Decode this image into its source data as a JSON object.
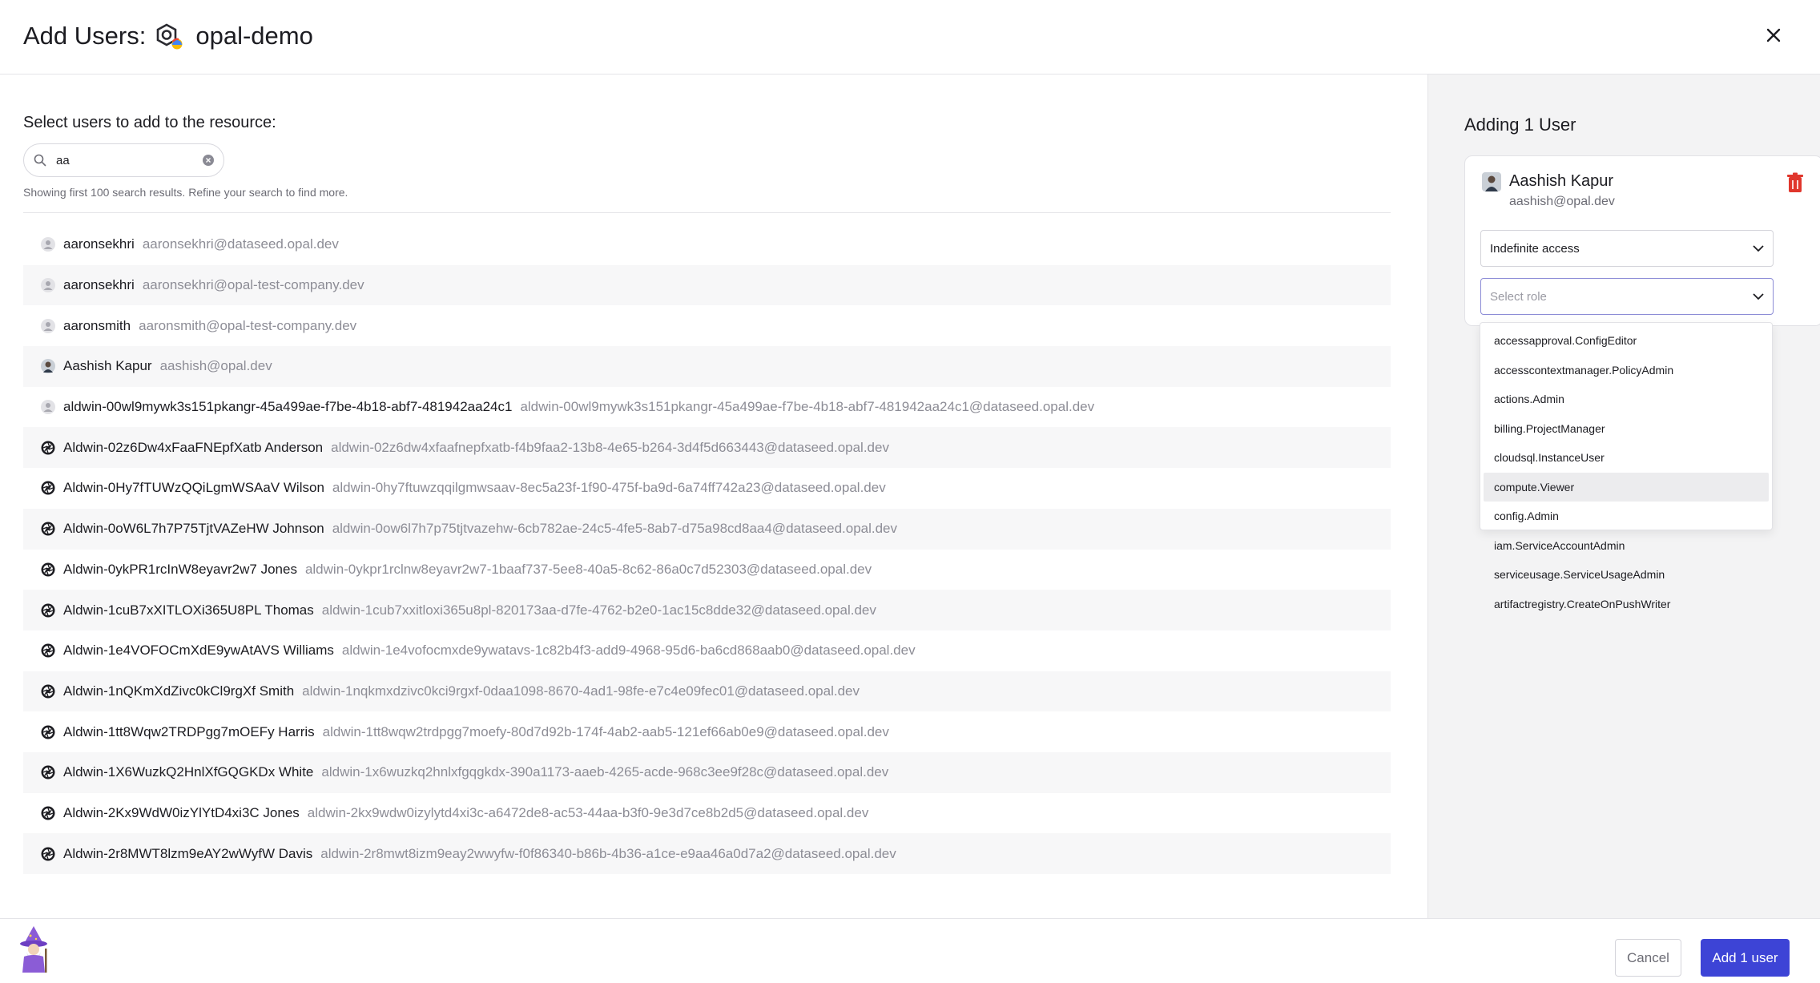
{
  "modal": {
    "title": "Add Users:",
    "resource_name": "opal-demo",
    "resource_icon": "gcp-project-icon"
  },
  "search": {
    "section_label": "Select users to add to the resource:",
    "value": "aa",
    "hint": "Showing first 100 search results. Refine your search to find more."
  },
  "users": [
    {
      "name": "aaronsekhri",
      "email": "aaronsekhri@dataseed.opal.dev",
      "avatar": "default"
    },
    {
      "name": "aaronsekhri",
      "email": "aaronsekhri@opal-test-company.dev",
      "avatar": "default"
    },
    {
      "name": "aaronsmith",
      "email": "aaronsmith@opal-test-company.dev",
      "avatar": "default"
    },
    {
      "name": "Aashish Kapur",
      "email": "aashish@opal.dev",
      "avatar": "photo"
    },
    {
      "name": "aldwin-00wl9mywk3s151pkangr-45a499ae-f7be-4b18-abf7-481942aa24c1",
      "email": "aldwin-00wl9mywk3s151pkangr-45a499ae-f7be-4b18-abf7-481942aa24c1@dataseed.opal.dev",
      "avatar": "default"
    },
    {
      "name": "Aldwin-02z6Dw4xFaaFNEpfXatb Anderson",
      "email": "aldwin-02z6dw4xfaafnepfxatb-f4b9faa2-13b8-4e65-b264-3d4f5d663443@dataseed.opal.dev",
      "avatar": "aperture"
    },
    {
      "name": "Aldwin-0Hy7fTUWzQQiLgmWSAaV Wilson",
      "email": "aldwin-0hy7ftuwzqqilgmwsaav-8ec5a23f-1f90-475f-ba9d-6a74ff742a23@dataseed.opal.dev",
      "avatar": "aperture"
    },
    {
      "name": "Aldwin-0oW6L7h7P75TjtVAZeHW Johnson",
      "email": "aldwin-0ow6l7h7p75tjtvazehw-6cb782ae-24c5-4fe5-8ab7-d75a98cd8aa4@dataseed.opal.dev",
      "avatar": "aperture"
    },
    {
      "name": "Aldwin-0ykPR1rcInW8eyavr2w7 Jones",
      "email": "aldwin-0ykpr1rclnw8eyavr2w7-1baaf737-5ee8-40a5-8c62-86a0c7d52303@dataseed.opal.dev",
      "avatar": "aperture"
    },
    {
      "name": "Aldwin-1cuB7xXITLOXi365U8PL Thomas",
      "email": "aldwin-1cub7xxitloxi365u8pl-820173aa-d7fe-4762-b2e0-1ac15c8dde32@dataseed.opal.dev",
      "avatar": "aperture"
    },
    {
      "name": "Aldwin-1e4VOFOCmXdE9ywAtAVS Williams",
      "email": "aldwin-1e4vofocmxde9ywatavs-1c82b4f3-add9-4968-95d6-ba6cd868aab0@dataseed.opal.dev",
      "avatar": "aperture"
    },
    {
      "name": "Aldwin-1nQKmXdZivc0kCl9rgXf Smith",
      "email": "aldwin-1nqkmxdzivc0kci9rgxf-0daa1098-8670-4ad1-98fe-e7c4e09fec01@dataseed.opal.dev",
      "avatar": "aperture"
    },
    {
      "name": "Aldwin-1tt8Wqw2TRDPgg7mOEFy Harris",
      "email": "aldwin-1tt8wqw2trdpgg7moefy-80d7d92b-174f-4ab2-aab5-121ef66ab0e9@dataseed.opal.dev",
      "avatar": "aperture"
    },
    {
      "name": "Aldwin-1X6WuzkQ2HnlXfGQGKDx White",
      "email": "aldwin-1x6wuzkq2hnlxfgqgkdx-390a1173-aaeb-4265-acde-968c3ee9f28c@dataseed.opal.dev",
      "avatar": "aperture"
    },
    {
      "name": "Aldwin-2Kx9WdW0izYlYtD4xi3C Jones",
      "email": "aldwin-2kx9wdw0izylytd4xi3c-a6472de8-ac53-44aa-b3f0-9e3d7ce8b2d5@dataseed.opal.dev",
      "avatar": "aperture"
    },
    {
      "name": "Aldwin-2r8MWT8lzm9eAY2wWyfW Davis",
      "email": "aldwin-2r8mwt8izm9eay2wwyfw-f0f86340-b86b-4b36-a1ce-e9aa46a0d7a2@dataseed.opal.dev",
      "avatar": "aperture"
    }
  ],
  "selection": {
    "title": "Adding 1 User",
    "user_name": "Aashish Kapur",
    "user_email": "aashish@opal.dev",
    "access_value": "Indefinite access",
    "role_placeholder": "Select role",
    "role_options": [
      "accessapproval.ConfigEditor",
      "accesscontextmanager.PolicyAdmin",
      "actions.Admin",
      "billing.ProjectManager",
      "cloudsql.InstanceUser",
      "compute.Viewer",
      "config.Admin",
      "iam.ServiceAccountAdmin",
      "serviceusage.ServiceUsageAdmin",
      "artifactregistry.CreateOnPushWriter"
    ],
    "highlighted_option": "compute.Viewer"
  },
  "footer": {
    "cancel_label": "Cancel",
    "submit_label": "Add 1 user"
  },
  "colors": {
    "primary": "#3d44d6",
    "danger": "#e0362c",
    "panel_bg": "#f3f3f4"
  }
}
